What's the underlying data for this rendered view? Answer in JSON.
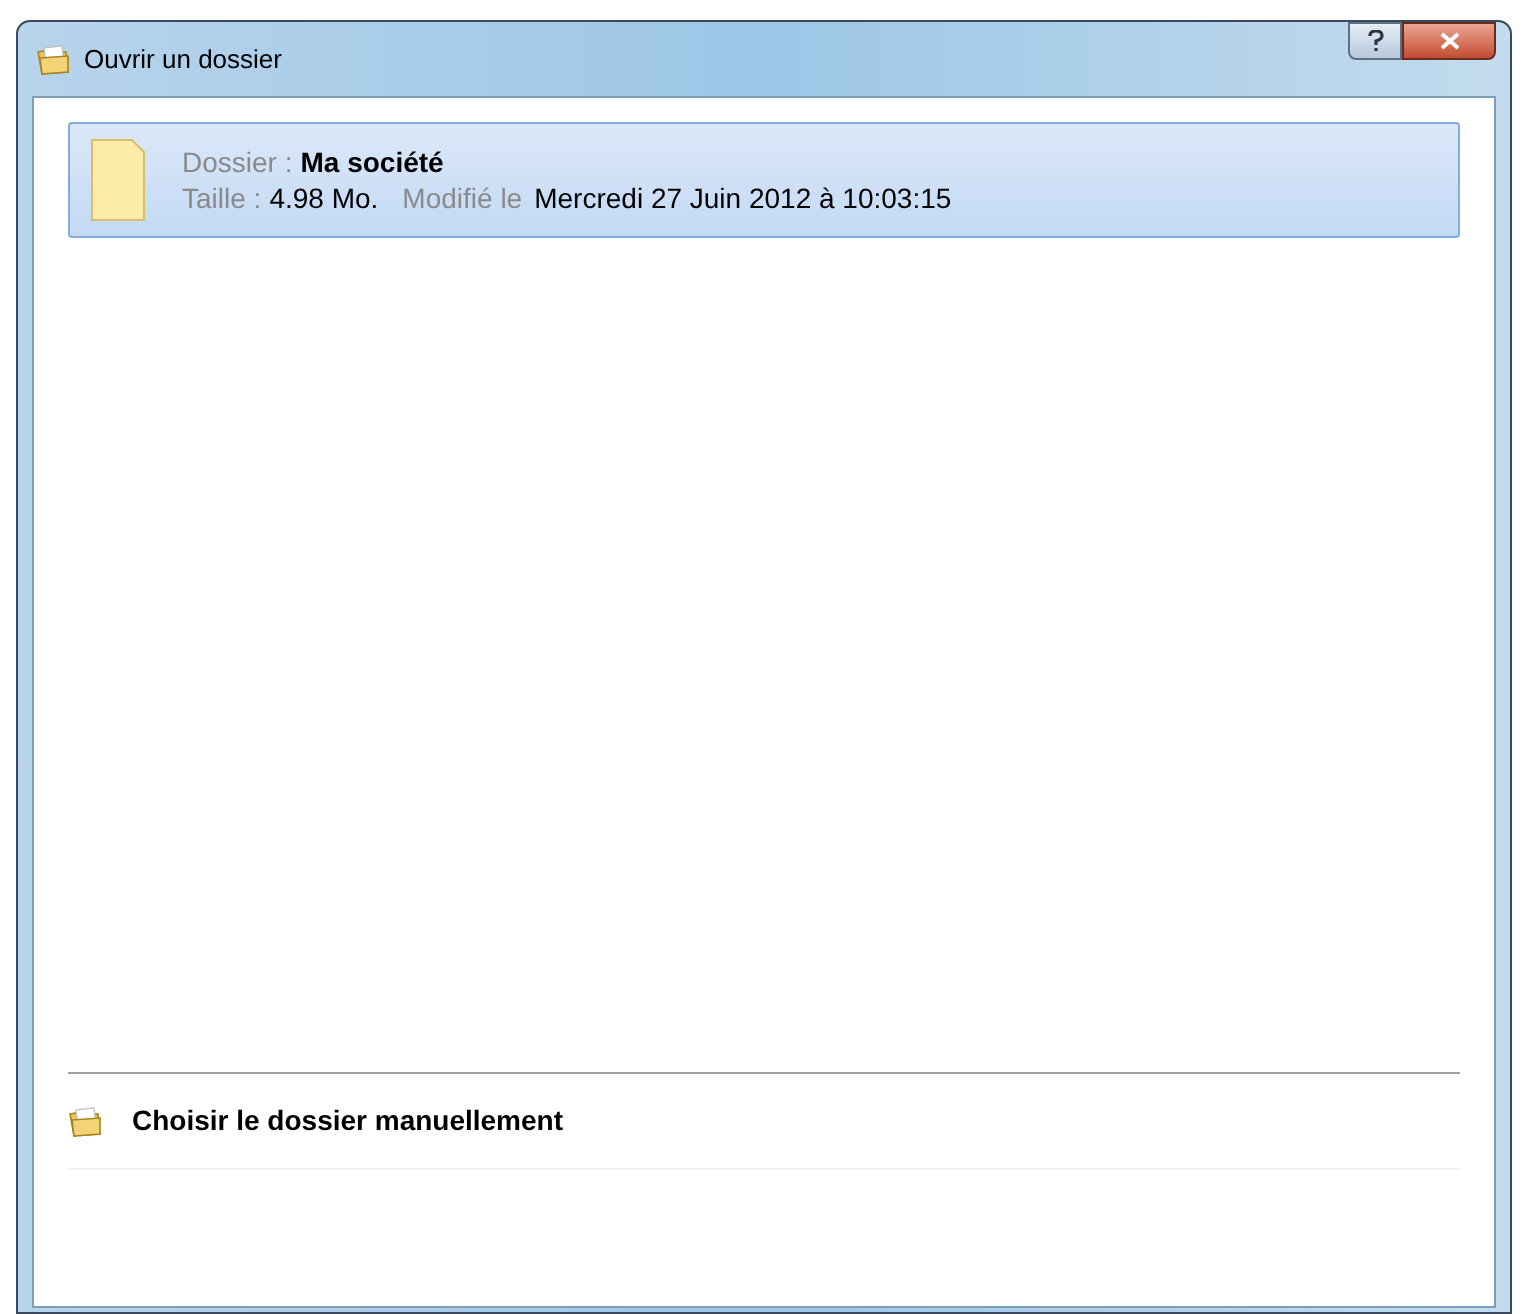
{
  "window": {
    "title": "Ouvrir un dossier"
  },
  "folders": [
    {
      "name_label": "Dossier :",
      "name": "Ma société",
      "size_label": "Taille :",
      "size": "4.98 Mo.",
      "modified_label": "Modifié le",
      "modified": "Mercredi 27 Juin 2012 à 10:03:15",
      "selected": true
    }
  ],
  "manual_action": {
    "label": "Choisir le dossier manuellement"
  }
}
